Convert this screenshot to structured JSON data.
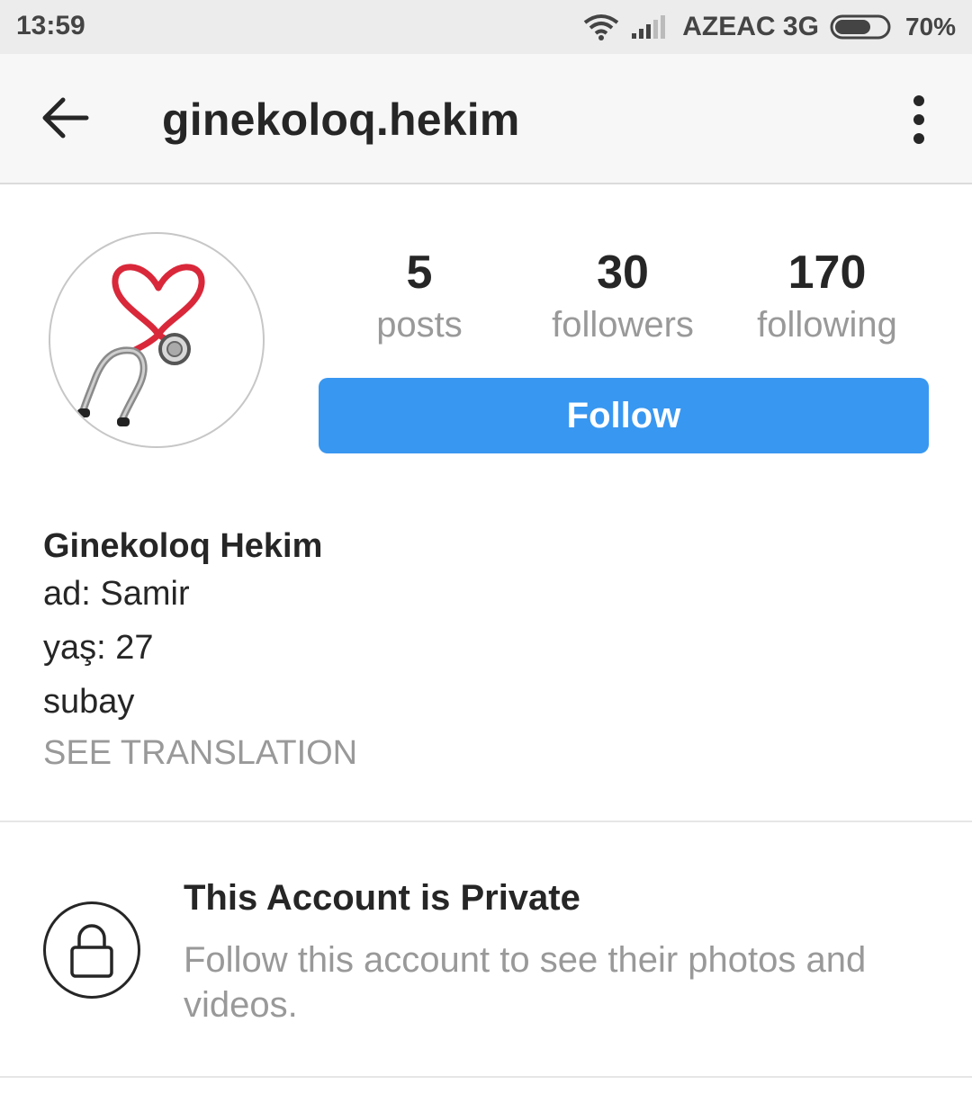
{
  "status_bar": {
    "time": "13:59",
    "carrier": "AZEAC 3G",
    "battery": "70%",
    "battery_level": 0.7,
    "icons": [
      "wifi-icon",
      "signal-icon",
      "battery-icon"
    ]
  },
  "header": {
    "title": "ginekoloq.hekim",
    "icons": [
      "back-arrow-icon",
      "more-vertical-icon"
    ]
  },
  "profile": {
    "avatar_icon": "stethoscope-heart-icon",
    "stats": [
      {
        "value": "5",
        "label": "posts"
      },
      {
        "value": "30",
        "label": "followers"
      },
      {
        "value": "170",
        "label": "following"
      }
    ],
    "follow_label": "Follow"
  },
  "bio": {
    "name": "Ginekoloq Hekim",
    "lines": [
      "ad: Samir",
      "yaş: 27",
      "subay"
    ],
    "translation_link": "SEE TRANSLATION"
  },
  "private_notice": {
    "icon": "lock-icon",
    "title": "This Account is Private",
    "description": "Follow this account to see their photos and videos."
  },
  "colors": {
    "accent": "#3897f0",
    "primary_text": "#262626",
    "secondary_text": "#999999",
    "heart": "#d9283a"
  }
}
